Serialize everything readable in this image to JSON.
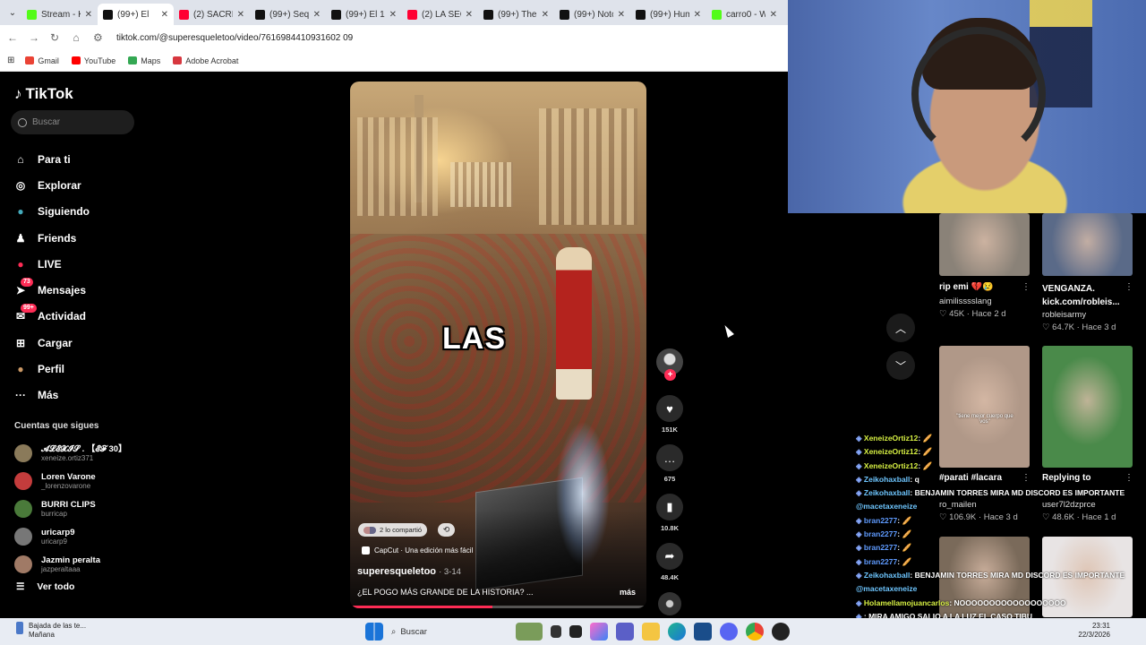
{
  "browser": {
    "tabs": [
      {
        "title": "Stream - K",
        "color": "#53fc18",
        "active": false
      },
      {
        "title": "(99+) El",
        "color": "#111111",
        "active": true
      },
      {
        "title": "(2) SACRI",
        "color": "#ff0033",
        "active": false
      },
      {
        "title": "(99+) Sequ",
        "color": "#111111",
        "active": false
      },
      {
        "title": "(99+) El 1",
        "color": "#111111",
        "active": false
      },
      {
        "title": "(2) LA SEC",
        "color": "#ff0033",
        "active": false
      },
      {
        "title": "(99+) The",
        "color": "#111111",
        "active": false
      },
      {
        "title": "(99+) Noto",
        "color": "#111111",
        "active": false
      },
      {
        "title": "(99+) Hum",
        "color": "#111111",
        "active": false
      },
      {
        "title": "carro0 - W",
        "color": "#53fc18",
        "active": false
      }
    ],
    "url": "tiktok.com/@superesqueletoo/video/7616984410931602 09",
    "bookmarks": [
      {
        "label": "Gmail",
        "color": "#ea4335"
      },
      {
        "label": "YouTube",
        "color": "#ff0000"
      },
      {
        "label": "Maps",
        "color": "#34a853"
      },
      {
        "label": "Adobe Acrobat",
        "color": "#d7373f"
      }
    ]
  },
  "tiktok": {
    "logo": "TikTok",
    "search_placeholder": "Buscar",
    "nav": [
      {
        "label": "Para ti",
        "icon": "home-icon",
        "glyph": "⌂"
      },
      {
        "label": "Explorar",
        "icon": "compass-icon",
        "glyph": "◎"
      },
      {
        "label": "Siguiendo",
        "icon": "following-icon",
        "glyph": "●"
      },
      {
        "label": "Friends",
        "icon": "friends-icon",
        "glyph": "♟"
      },
      {
        "label": "LIVE",
        "icon": "live-icon",
        "glyph": "●"
      },
      {
        "label": "Mensajes",
        "icon": "messages-icon",
        "glyph": "➤",
        "badge": "73"
      },
      {
        "label": "Actividad",
        "icon": "activity-icon",
        "glyph": "✉",
        "badge": "99+"
      },
      {
        "label": "Cargar",
        "icon": "upload-icon",
        "glyph": "⊞"
      },
      {
        "label": "Perfil",
        "icon": "profile-icon",
        "glyph": "●"
      },
      {
        "label": "Más",
        "icon": "more-icon",
        "glyph": "···"
      }
    ],
    "following_title": "Cuentas que sigues",
    "following": [
      {
        "name": "𝓐𝓛𝓔𝓧𝓘𝓢 . 【𝓔𝓕 30】",
        "handle": "xeneize.ortiz371",
        "color": "#8a7a5a"
      },
      {
        "name": "Loren Varone",
        "handle": "_lorenzovarone",
        "color": "#c43c3c"
      },
      {
        "name": "BURRI CLIPS",
        "handle": "burricap",
        "color": "#4a7a3a"
      },
      {
        "name": "uricarp9",
        "handle": "uricarp9",
        "color": "#777777"
      },
      {
        "name": "Jazmin peralta",
        "handle": "jazperaltaaa",
        "color": "#a07a66"
      }
    ],
    "see_all": "Ver todo"
  },
  "video": {
    "caption_word": "LAS",
    "shared_label": "2 lo compartió",
    "capcut_label": "CapCut · Una edición más fácil",
    "author": "superesqueletoo",
    "date": "· 3-14",
    "description": "¿EL POGO MÁS GRANDE DE LA HISTORIA? ...",
    "more": "más",
    "progress": 0.48,
    "likes": "151K",
    "comments": "675",
    "saves": "10.8K",
    "shares": "48.4K"
  },
  "recommended": [
    {
      "title": "rip emi 💔😢",
      "author": "aimilisssslang",
      "stats": "♡ 45K · Hace 2 d",
      "color": "#8a8278"
    },
    {
      "title": "VENGANZA. kick.com/robleis...",
      "author": "robleisarmy",
      "stats": "♡ 64.7K · Hace 3 d",
      "color": "#5a6a88"
    },
    {
      "title": "#parati #lacara",
      "author": "ro_mailen",
      "stats": "♡ 106.9K · Hace 3 d",
      "color": "#b09888"
    },
    {
      "title": "Replying to",
      "author": "user7l2dzprce",
      "stats": "♡ 48.6K · Hace 1 d",
      "color": "#4a8a4a"
    },
    {
      "title": "",
      "author": "",
      "stats": "",
      "color": "#7a6a5a"
    },
    {
      "title": "",
      "author": "",
      "stats": "",
      "color": "#e8e4e4"
    }
  ],
  "tile_texts": {
    "tile3_overlay": "\"tiene mejor cuerpo que vos\""
  },
  "chat": [
    {
      "user": "XeneizeOrtiz12",
      "msg": ": 🥖",
      "cls": "u"
    },
    {
      "user": "XeneizeOrtiz12",
      "msg": ": 🥖",
      "cls": "u"
    },
    {
      "user": "XeneizeOrtiz12",
      "msg": ": 🥖",
      "cls": "u"
    },
    {
      "user": "Zeikohaxball",
      "msg": ": q",
      "cls": "u2"
    },
    {
      "user": "Zeikohaxball",
      "msg": ": BENJAMIN TORRES MIRA MD DISCORD ES IMPORTANTE",
      "cls": "u2"
    },
    {
      "user": "",
      "msg": "@macetaxeneize",
      "cls": "mention"
    },
    {
      "user": "bran2277",
      "msg": ": 🥖",
      "cls": "u3"
    },
    {
      "user": "bran2277",
      "msg": ": 🥖",
      "cls": "u3"
    },
    {
      "user": "bran2277",
      "msg": ": 🥖",
      "cls": "u3"
    },
    {
      "user": "bran2277",
      "msg": ": 🥖",
      "cls": "u3"
    },
    {
      "user": "Zeikohaxball",
      "msg": ": BENJAMIN TORRES MIRA MD DISCORD ES IMPORTANTE",
      "cls": "u2"
    },
    {
      "user": "",
      "msg": "@macetaxeneize",
      "cls": "mention"
    },
    {
      "user": "Holamellamojuancarlos",
      "msg": ": NOOOOOOOOOOOOOOOOOO",
      "cls": "u"
    },
    {
      "user": "",
      "msg": ": MIRA AMIGO SALIO A LA LUZ EL CASO TIBU",
      "cls": "u"
    }
  ],
  "taskbar": {
    "weather_line1": "Bajada de las te...",
    "weather_line2": "Mañana",
    "search": "Buscar",
    "time": "23:31",
    "date": "22/3/2026"
  }
}
